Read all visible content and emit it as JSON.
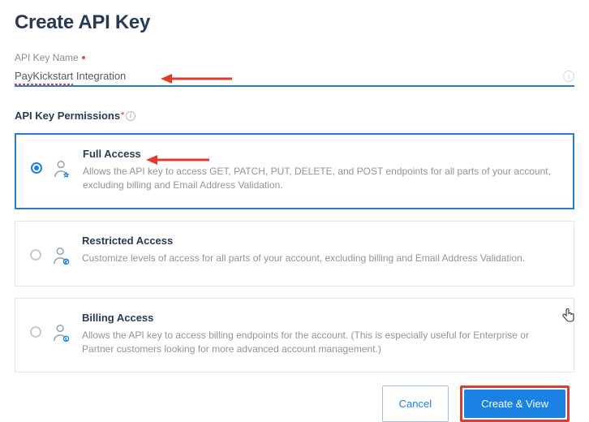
{
  "page": {
    "title": "Create API Key"
  },
  "name_field": {
    "label": "API Key Name",
    "value": "PayKickstart Integration",
    "spell_err_word": "PayKickstart"
  },
  "permissions": {
    "label": "API Key Permissions",
    "options": [
      {
        "key": "full",
        "title": "Full Access",
        "desc": "Allows the API key to access GET, PATCH, PUT, DELETE, and POST endpoints for all parts of your account, excluding billing and Email Address Validation.",
        "selected": true
      },
      {
        "key": "restricted",
        "title": "Restricted Access",
        "desc": "Customize levels of access for all parts of your account, excluding billing and Email Address Validation.",
        "selected": false
      },
      {
        "key": "billing",
        "title": "Billing Access",
        "desc": "Allows the API key to access billing endpoints for the account. (This is especially useful for Enterprise or Partner customers looking for more advanced account management.)",
        "selected": false
      }
    ]
  },
  "buttons": {
    "cancel": "Cancel",
    "submit": "Create & View"
  }
}
